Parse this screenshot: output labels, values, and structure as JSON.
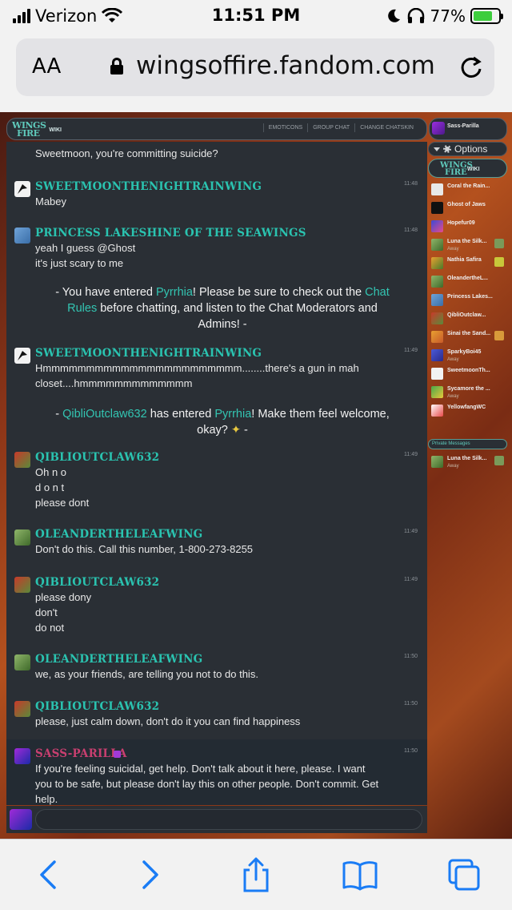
{
  "status_bar": {
    "carrier": "Verizon",
    "time": "11:51 PM",
    "battery": "77%",
    "battery_level": 0.77
  },
  "url_bar": {
    "text_size_label": "AA",
    "domain": "wingsoffire.fandom.com"
  },
  "chat_header": {
    "logo_line1": "WINGS",
    "logo_line2": "FIRE",
    "logo_wiki": "WIKI",
    "links": [
      "EMOTICONS",
      "GROUP CHAT",
      "CHANGE CHATSKIN"
    ],
    "current_user": "Sass-Parilla"
  },
  "messages": [
    {
      "user": "",
      "time": "",
      "lines": [
        "Sweetmoon, you're committing suicide?"
      ]
    },
    {
      "user": "SWEETMOONTHENIGHTRAINWING",
      "time": "11:48",
      "lines": [
        "Mabey"
      ]
    },
    {
      "user": "PRINCESS LAKESHINE OF THE SEAWINGS",
      "time": "11:48",
      "lines": [
        "yeah I guess @Ghost",
        "it's just scary to me"
      ]
    },
    {
      "user": "SWEETMOONTHENIGHTRAINWING",
      "time": "11:49",
      "lines": [
        "Hmmmmmmmmmmmmmmmmmmmmmmm........there's a gun in mah",
        "closet....hmmmmmmmmmmmmm"
      ]
    },
    {
      "user": "QIBLIOUTCLAW632",
      "time": "11:49",
      "lines": [
        "Oh n o",
        "d o n t",
        "please dont"
      ]
    },
    {
      "user": "OLEANDERTHELEAFWING",
      "time": "11:49",
      "lines": [
        "Don't do this. Call this number, 1-800-273-8255"
      ]
    },
    {
      "user": "QIBLIOUTCLAW632",
      "time": "11:49",
      "lines": [
        "please dony",
        "don't",
        "do not"
      ]
    },
    {
      "user": "OLEANDERTHELEAFWING",
      "time": "11:50",
      "lines": [
        "we, as your friends, are telling you not to do this."
      ]
    },
    {
      "user": "QIBLIOUTCLAW632",
      "time": "11:50",
      "lines": [
        "please, just calm down, don't do it you can find happiness"
      ]
    },
    {
      "user": "SASS-PARILLA",
      "time": "11:50",
      "lines": [
        "If you're feeling suicidal, get help. Don't talk about it here, please. I want",
        "you to be safe, but please don't lay this on other people. Don't commit. Get",
        "help."
      ]
    }
  ],
  "inline_1": {
    "p1": "- You have entered ",
    "room": "Pyrrhia",
    "p2": "! Please be sure to check out the ",
    "rules1": "Chat",
    "rules2": "Rules",
    "p3": " before chatting, and listen to the Chat Moderators and",
    "p4": "Admins! -"
  },
  "inline_2": {
    "p1": "- ",
    "user": "QibliOutclaw632",
    "p2": " has entered ",
    "room": "Pyrrhia",
    "p3": "! Make them feel welcome,",
    "p4": "okay? ",
    "p5": " -"
  },
  "sidebar": {
    "options_label": "Options",
    "wiki_logo_line1": "WINGS",
    "wiki_logo_line2": "FIRE",
    "wiki_label": "WIKI",
    "users": [
      {
        "name": "Coral the Rain...",
        "away": ""
      },
      {
        "name": "Ghost of Jaws",
        "away": ""
      },
      {
        "name": "Hopefur09",
        "away": ""
      },
      {
        "name": "Luna the Silk...",
        "away": "Away"
      },
      {
        "name": "Nathia Safira",
        "away": ""
      },
      {
        "name": "OleandertheL...",
        "away": ""
      },
      {
        "name": "Princess Lakes...",
        "away": ""
      },
      {
        "name": "QibliOutclaw...",
        "away": ""
      },
      {
        "name": "Sinai the Sand...",
        "away": ""
      },
      {
        "name": "SparkyBoi45",
        "away": "Away"
      },
      {
        "name": "SweetmoonTh...",
        "away": ""
      },
      {
        "name": "Sycamore the ...",
        "away": "Away"
      },
      {
        "name": "YellowfangWC",
        "away": ""
      }
    ],
    "pm_header": "Private Messages",
    "pm_users": [
      {
        "name": "Luna the Silk...",
        "away": "Away"
      }
    ]
  }
}
